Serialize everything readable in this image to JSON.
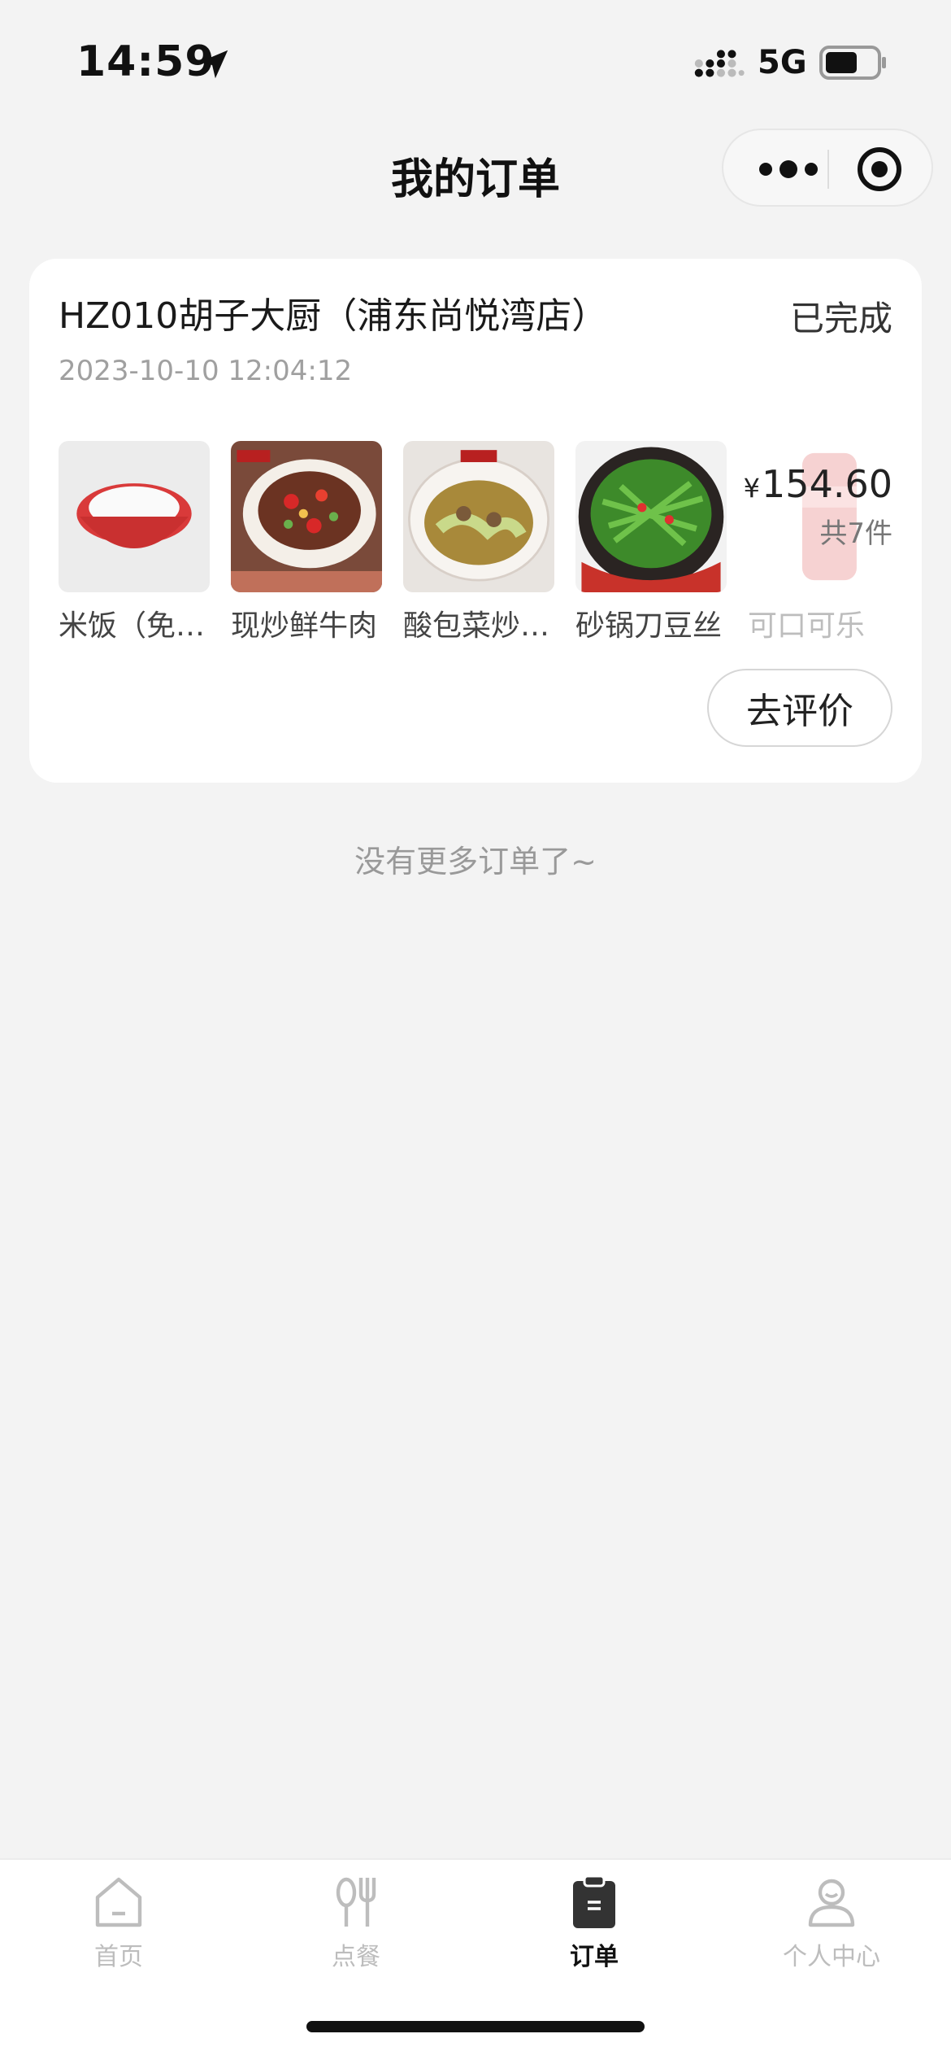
{
  "status_bar": {
    "time": "14:59",
    "network": "5G"
  },
  "nav": {
    "title": "我的订单"
  },
  "order": {
    "store_name": "HZ010胡子大厨（浦东尚悦湾店）",
    "status": "已完成",
    "datetime": "2023-10-10 12:04:12",
    "items": [
      {
        "name": "米饭（免…",
        "icon": "rice-bowl"
      },
      {
        "name": "现炒鲜牛肉",
        "icon": "stir-fried-beef"
      },
      {
        "name": "酸包菜炒…",
        "icon": "sour-cabbage-dish"
      },
      {
        "name": "砂锅刀豆丝",
        "icon": "green-beans-claypot"
      },
      {
        "name": "可口可乐",
        "icon": "cola-can"
      }
    ],
    "currency": "¥",
    "price": "154.60",
    "count": "共7件",
    "review_label": "去评价"
  },
  "footer_text": "没有更多订单了~",
  "tabs": [
    {
      "label": "首页",
      "icon": "home-icon",
      "active": false
    },
    {
      "label": "点餐",
      "icon": "utensils-icon",
      "active": false
    },
    {
      "label": "订单",
      "icon": "order-clipboard-icon",
      "active": true
    },
    {
      "label": "个人中心",
      "icon": "user-icon",
      "active": false
    }
  ],
  "colors": {
    "background": "#f3f3f3",
    "card": "#ffffff",
    "active_tab": "#111111",
    "inactive_tab": "#bdbdbd"
  }
}
